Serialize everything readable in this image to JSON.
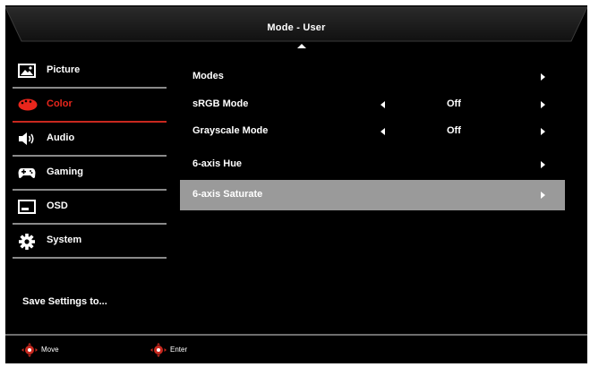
{
  "header": {
    "title": "Mode - User"
  },
  "sidebar": {
    "items": [
      {
        "label": "Picture",
        "icon": "picture-icon",
        "active": false
      },
      {
        "label": "Color",
        "icon": "color-palette-icon",
        "active": true
      },
      {
        "label": "Audio",
        "icon": "speaker-icon",
        "active": false
      },
      {
        "label": "Gaming",
        "icon": "gamepad-icon",
        "active": false
      },
      {
        "label": "OSD",
        "icon": "osd-icon",
        "active": false
      },
      {
        "label": "System",
        "icon": "gear-icon",
        "active": false
      }
    ],
    "save_label": "Save Settings to..."
  },
  "main": {
    "rows": [
      {
        "label": "Modes",
        "value": "",
        "has_left": false,
        "has_right": true,
        "highlighted": false
      },
      {
        "label": "sRGB Mode",
        "value": "Off",
        "has_left": true,
        "has_right": true,
        "highlighted": false
      },
      {
        "label": "Grayscale Mode",
        "value": "Off",
        "has_left": true,
        "has_right": true,
        "highlighted": false
      },
      {
        "label": "6-axis Hue",
        "value": "",
        "has_left": false,
        "has_right": true,
        "highlighted": false
      },
      {
        "label": "6-axis Saturate",
        "value": "",
        "has_left": false,
        "has_right": true,
        "highlighted": true
      }
    ]
  },
  "footer": {
    "move_label": "Move",
    "enter_label": "Enter"
  },
  "colors": {
    "accent_red": "#e8261c",
    "highlight_gray": "#9a9a9a",
    "background": "#000000"
  }
}
